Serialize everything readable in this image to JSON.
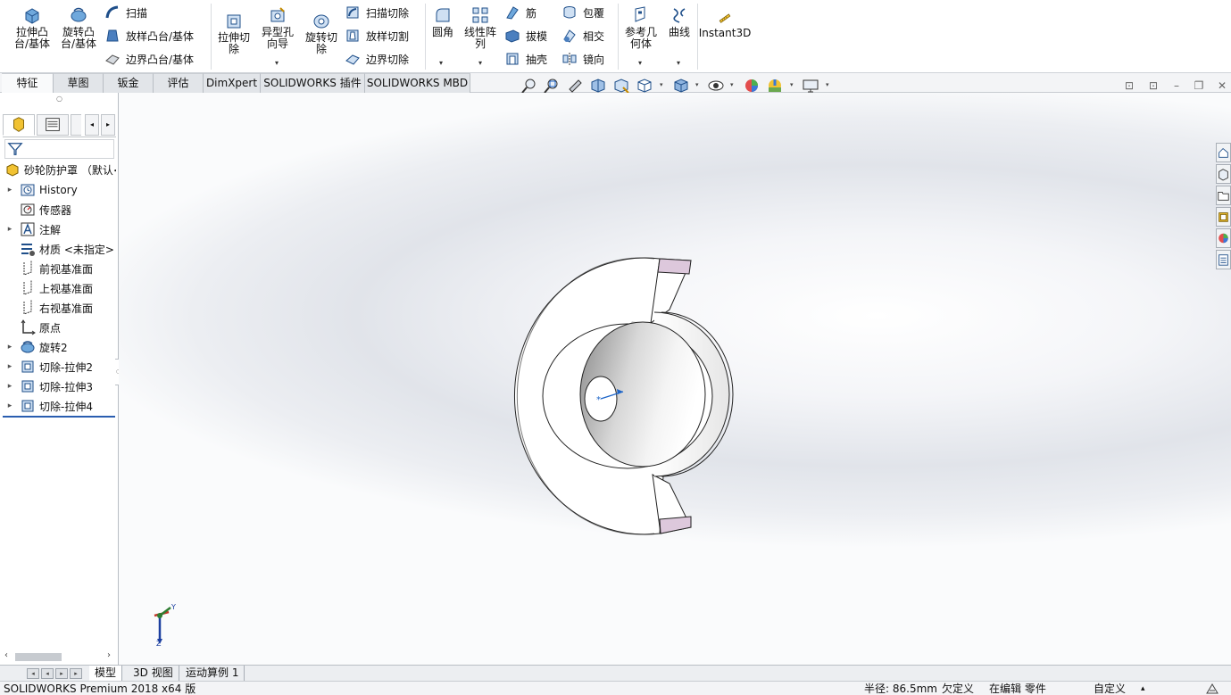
{
  "ribbon": {
    "extrude_boss": "拉伸凸\n台/基体",
    "revolve_boss": "旋转凸\n台/基体",
    "sweep": "扫描",
    "loft": "放样凸台/基体",
    "boundary_boss": "边界凸台/基体",
    "extrude_cut": "拉伸切\n除",
    "hole_wizard": "异型孔\n向导",
    "revolve_cut": "旋转切\n除",
    "swept_cut": "扫描切除",
    "lofted_cut": "放样切割",
    "boundary_cut": "边界切除",
    "fillet": "圆角",
    "linear_pattern": "线性阵\n列",
    "rib": "筋",
    "draft": "拔模",
    "shell": "抽壳",
    "wrap": "包覆",
    "intersect": "相交",
    "mirror": "镜向",
    "ref_geometry": "参考几\n何体",
    "curves": "曲线",
    "instant3d": "Instant3D"
  },
  "command_tabs": [
    "特征",
    "草图",
    "钣金",
    "评估",
    "DimXpert",
    "SOLIDWORKS 插件",
    "SOLIDWORKS MBD"
  ],
  "tree": {
    "root": "砂轮防护罩 （默认<",
    "items": [
      {
        "label": "History",
        "icon": "history-icon",
        "arrow": "▸"
      },
      {
        "label": "传感器",
        "icon": "sensor-icon",
        "arrow": ""
      },
      {
        "label": "注解",
        "icon": "annotation-icon",
        "arrow": "▸"
      },
      {
        "label": "材质 <未指定>",
        "icon": "material-icon",
        "arrow": ""
      },
      {
        "label": "前视基准面",
        "icon": "plane-icon",
        "arrow": ""
      },
      {
        "label": "上视基准面",
        "icon": "plane-icon",
        "arrow": ""
      },
      {
        "label": "右视基准面",
        "icon": "plane-icon",
        "arrow": ""
      },
      {
        "label": "原点",
        "icon": "origin-icon",
        "arrow": ""
      },
      {
        "label": "旋转2",
        "icon": "revolve-feature-icon",
        "arrow": "▸"
      },
      {
        "label": "切除-拉伸2",
        "icon": "cut-extrude-icon",
        "arrow": "▸"
      },
      {
        "label": "切除-拉伸3",
        "icon": "cut-extrude-icon",
        "arrow": "▸"
      },
      {
        "label": "切除-拉伸4",
        "icon": "cut-extrude-icon",
        "arrow": "▸"
      }
    ]
  },
  "triad": {
    "y": "Y",
    "z": "Z"
  },
  "bottom_tabs": [
    "模型",
    "3D 视图",
    "运动算例 1"
  ],
  "status": {
    "app": "SOLIDWORKS Premium 2018 x64 版",
    "radius": "半径: 86.5mm",
    "definition": "欠定义",
    "editing": "在编辑 零件",
    "units": "自定义",
    "caret": "▴"
  },
  "colors": {
    "accent": "#1c64c8",
    "face_pink": "#ddc8dc",
    "tree_line": "#2a5db0"
  }
}
